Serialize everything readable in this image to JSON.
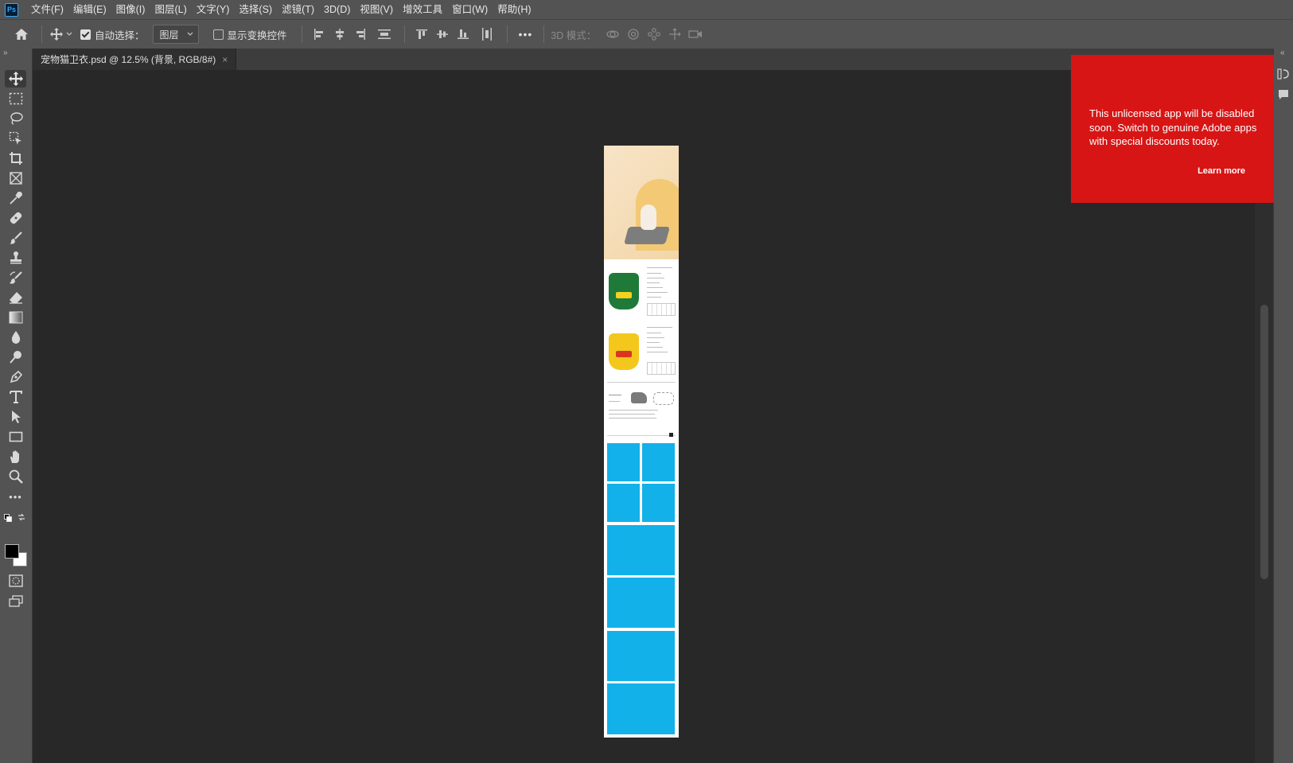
{
  "app": {
    "logo": "Ps"
  },
  "menu": [
    "文件(F)",
    "编辑(E)",
    "图像(I)",
    "图层(L)",
    "文字(Y)",
    "选择(S)",
    "滤镜(T)",
    "3D(D)",
    "视图(V)",
    "增效工具",
    "窗口(W)",
    "帮助(H)"
  ],
  "options": {
    "auto_select_label": "自动选择：",
    "auto_select_checked": true,
    "auto_select_target": "图层",
    "show_transform_label": "显示变换控件",
    "show_transform_checked": false,
    "more": "•••",
    "mode_3d_label": "3D 模式："
  },
  "tab": {
    "title": "宠物猫卫衣.psd @ 12.5% (背景, RGB/8#)",
    "close": "×"
  },
  "notice": {
    "message": "This unlicensed app will be disabled soon. Switch to genuine Adobe apps with special discounts today.",
    "link": "Learn more",
    "color": "#d71515"
  },
  "colors": {
    "foreground": "#000000",
    "background": "#ffffff",
    "placeholder_blue": "#12b1ea"
  }
}
